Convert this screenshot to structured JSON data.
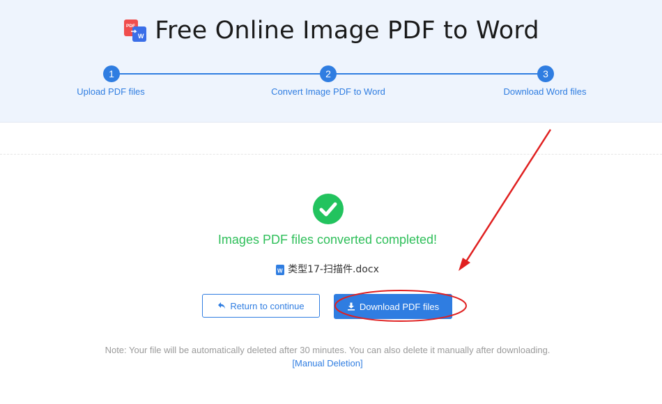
{
  "header": {
    "title": "Free Online Image PDF to Word",
    "logo": {
      "pdf_text": "PDF",
      "word_text": "W"
    }
  },
  "steps": [
    {
      "number": "1",
      "label": "Upload PDF files"
    },
    {
      "number": "2",
      "label": "Convert Image PDF to Word"
    },
    {
      "number": "3",
      "label": "Download Word files"
    }
  ],
  "result": {
    "message": "Images PDF files converted completed!",
    "file_name": "类型17-扫描件.docx"
  },
  "buttons": {
    "return_label": "Return to continue",
    "download_label": "Download PDF files"
  },
  "note": {
    "text": "Note: Your file will be automatically deleted after 30 minutes. You can also delete it manually after downloading.",
    "link_text": "[Manual Deletion]"
  },
  "colors": {
    "accent": "#2f7de1",
    "success": "#22c35e",
    "annotation": "#e02020"
  },
  "icons": {
    "success": "check-circle-icon",
    "file": "word-file-icon",
    "return": "return-arrow-icon",
    "download": "download-icon"
  }
}
